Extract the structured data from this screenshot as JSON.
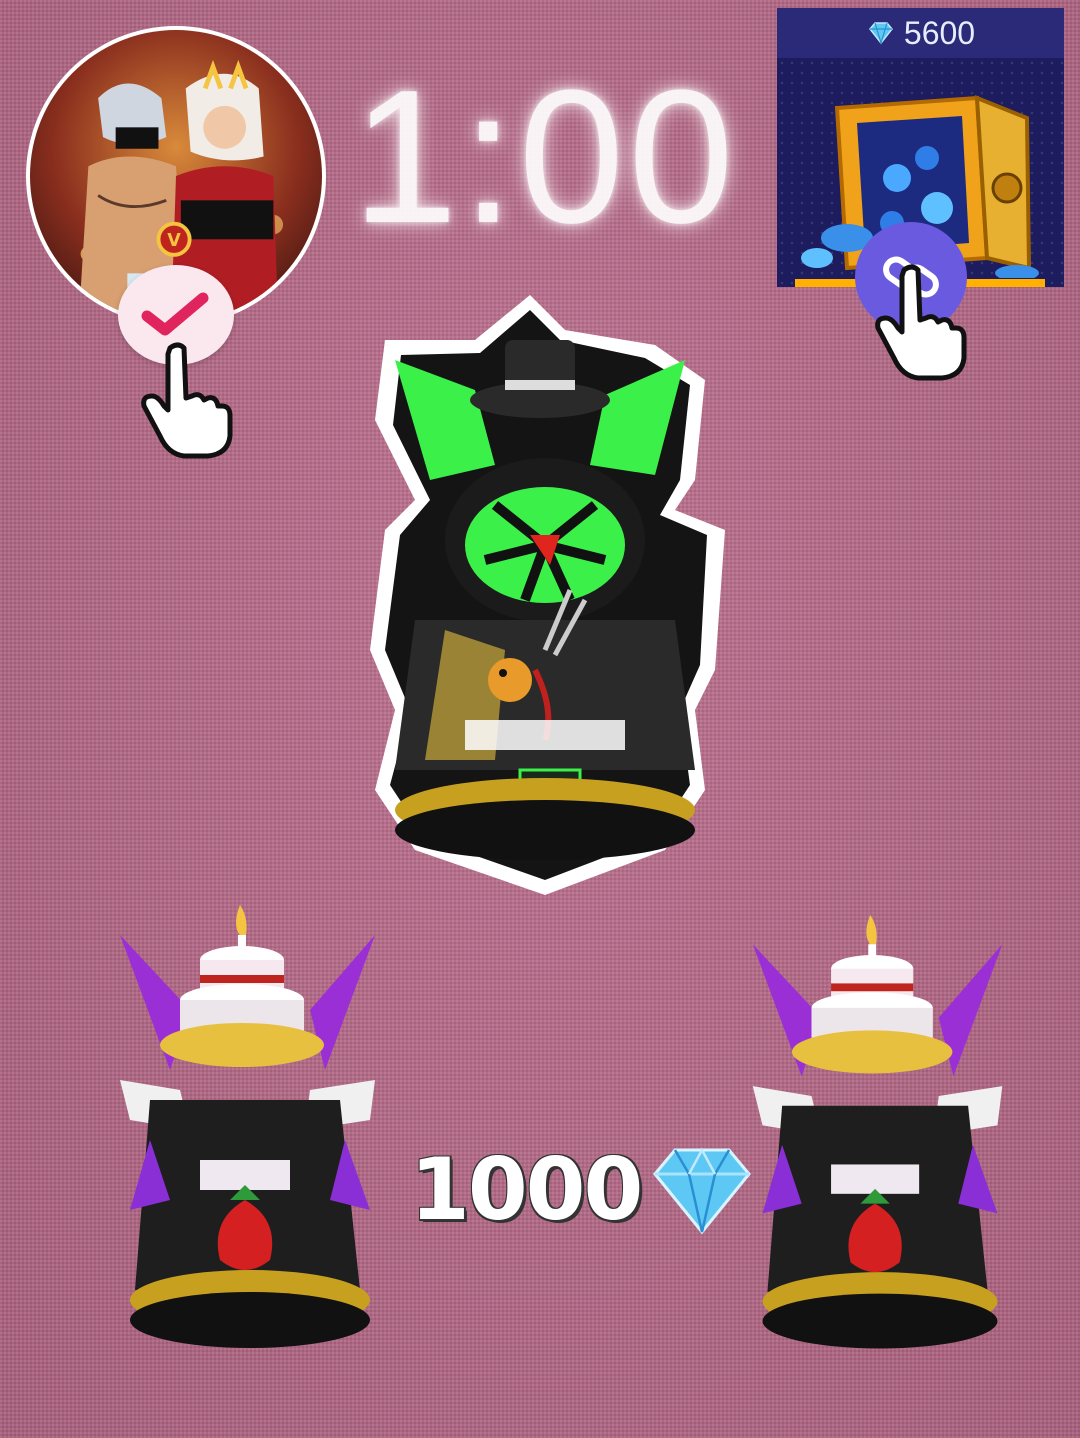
{
  "timer": {
    "text": "1:00"
  },
  "shop": {
    "gem_count": "5600"
  },
  "price": {
    "value": "1000"
  },
  "icons": {
    "avatar": "profile-avatar",
    "check": "check-icon",
    "link": "link-icon",
    "hand": "hand-pointer-icon",
    "gem": "diamond-icon",
    "vault": "diamond-vault"
  },
  "colors": {
    "background": "#b46a86",
    "check": "#e0245e",
    "link_button": "#6a5ae0",
    "panel": "#1c1c5e",
    "gem": "#5ec8f5"
  }
}
